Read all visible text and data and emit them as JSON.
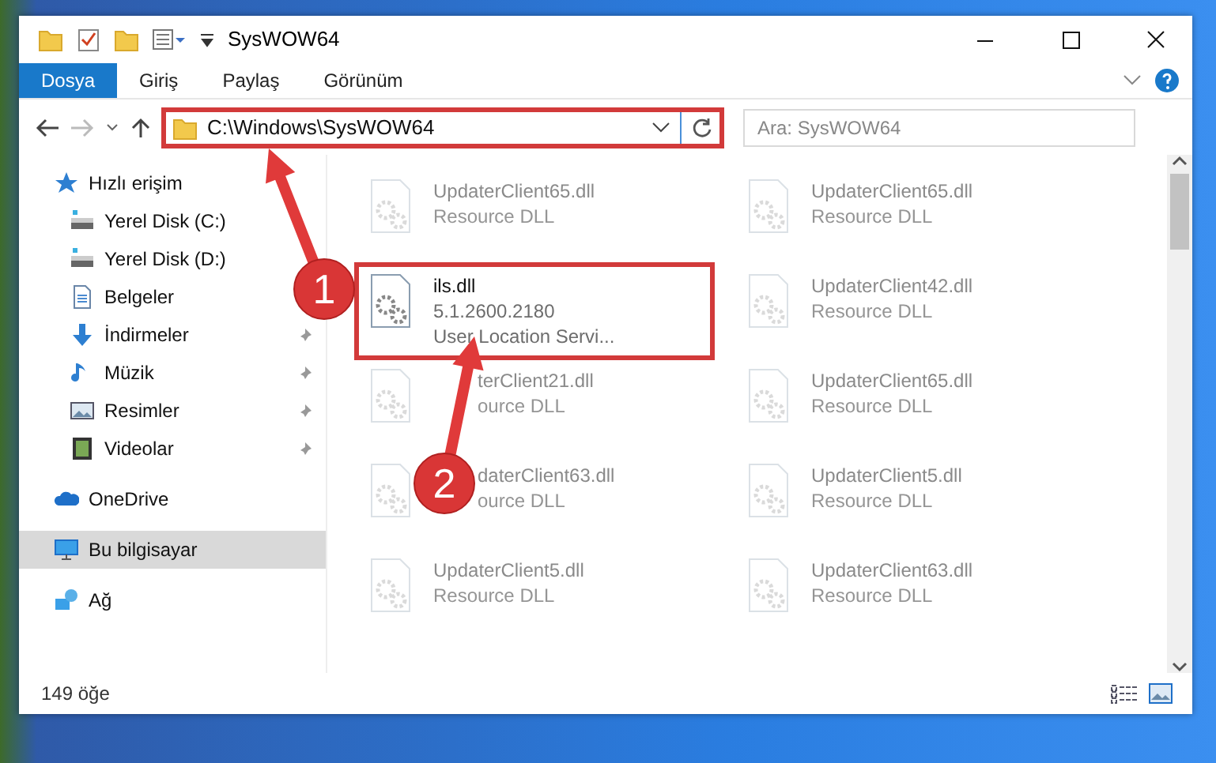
{
  "window": {
    "title": "SysWOW64"
  },
  "ribbon_tabs": [
    {
      "label": "Dosya",
      "selected": true
    },
    {
      "label": "Giriş",
      "selected": false
    },
    {
      "label": "Paylaş",
      "selected": false
    },
    {
      "label": "Görünüm",
      "selected": false
    }
  ],
  "address": {
    "path": "C:\\Windows\\SysWOW64",
    "highlighted": true
  },
  "search": {
    "placeholder": "Ara: SysWOW64"
  },
  "nav": [
    {
      "label": "Hızlı erişim",
      "kind": "star",
      "pinned": false,
      "selected": false,
      "children": [
        {
          "label": "Yerel Disk (C:)",
          "kind": "drive",
          "pinned": false,
          "selected": false
        },
        {
          "label": "Yerel Disk (D:)",
          "kind": "drive",
          "pinned": false,
          "selected": false
        },
        {
          "label": "Belgeler",
          "kind": "document",
          "pinned": false,
          "selected": false
        },
        {
          "label": "İndirmeler",
          "kind": "download",
          "pinned": true,
          "selected": false
        },
        {
          "label": "Müzik",
          "kind": "music",
          "pinned": true,
          "selected": false
        },
        {
          "label": "Resimler",
          "kind": "pictures",
          "pinned": true,
          "selected": false
        },
        {
          "label": "Videolar",
          "kind": "video",
          "pinned": true,
          "selected": false
        }
      ]
    },
    {
      "label": "OneDrive",
      "kind": "cloud",
      "pinned": false,
      "selected": false
    },
    {
      "label": "Bu bilgisayar",
      "kind": "computer",
      "pinned": false,
      "selected": true
    },
    {
      "label": "Ağ",
      "kind": "network",
      "pinned": false,
      "selected": false
    }
  ],
  "files": [
    {
      "name": "UpdaterClient65.dll",
      "details": [
        "Resource DLL"
      ],
      "dimmed": true,
      "highlighted": false,
      "covered": false
    },
    {
      "name": "UpdaterClient65.dll",
      "details": [
        "Resource DLL"
      ],
      "dimmed": true,
      "highlighted": false,
      "covered": false
    },
    {
      "name": "ils.dll",
      "details": [
        "5.1.2600.2180",
        "User Location Servi..."
      ],
      "dimmed": false,
      "highlighted": true,
      "covered": false
    },
    {
      "name": "UpdaterClient42.dll",
      "details": [
        "Resource DLL"
      ],
      "dimmed": true,
      "highlighted": false,
      "covered": false
    },
    {
      "name": "terClient21.dll",
      "details": [
        "ource DLL"
      ],
      "dimmed": true,
      "highlighted": false,
      "covered": true
    },
    {
      "name": "UpdaterClient65.dll",
      "details": [
        "Resource DLL"
      ],
      "dimmed": true,
      "highlighted": false,
      "covered": false
    },
    {
      "name": "daterClient63.dll",
      "details": [
        "ource DLL"
      ],
      "dimmed": true,
      "highlighted": false,
      "covered": true
    },
    {
      "name": "UpdaterClient5.dll",
      "details": [
        "Resource DLL"
      ],
      "dimmed": true,
      "highlighted": false,
      "covered": false
    },
    {
      "name": "UpdaterClient5.dll",
      "details": [
        "Resource DLL"
      ],
      "dimmed": true,
      "highlighted": false,
      "covered": false
    },
    {
      "name": "UpdaterClient63.dll",
      "details": [
        "Resource DLL"
      ],
      "dimmed": true,
      "highlighted": false,
      "covered": false
    }
  ],
  "status_bar": {
    "count": "149 öğe"
  },
  "callouts": [
    {
      "number": "1"
    },
    {
      "number": "2"
    }
  ]
}
